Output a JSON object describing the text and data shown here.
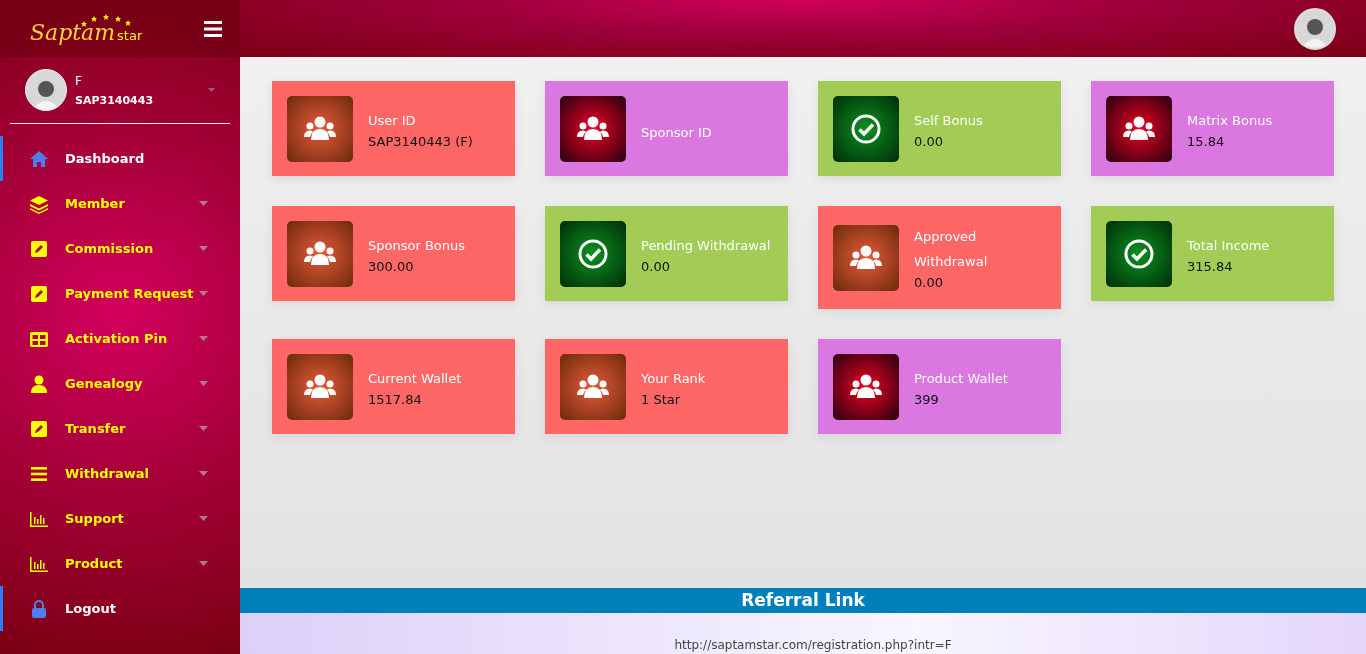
{
  "brand": {
    "logo_main": "Saptam",
    "logo_sub": "star"
  },
  "user": {
    "name": "F",
    "id": "SAP3140443"
  },
  "sidebar": {
    "items": [
      {
        "label": "Dashboard",
        "kind": "link"
      },
      {
        "label": "Member",
        "kind": "dropdown"
      },
      {
        "label": "Commission",
        "kind": "dropdown"
      },
      {
        "label": "Payment Request",
        "kind": "dropdown"
      },
      {
        "label": "Activation Pin",
        "kind": "dropdown"
      },
      {
        "label": "Genealogy",
        "kind": "dropdown"
      },
      {
        "label": "Transfer",
        "kind": "dropdown"
      },
      {
        "label": "Withdrawal",
        "kind": "dropdown"
      },
      {
        "label": "Support",
        "kind": "dropdown"
      },
      {
        "label": "Product",
        "kind": "dropdown"
      },
      {
        "label": "Logout",
        "kind": "link"
      }
    ]
  },
  "cards": [
    {
      "title": "User ID",
      "value": "SAP3140443 (F)",
      "color": "#ff6666",
      "kind": "users"
    },
    {
      "title": "Sponsor ID",
      "color": "#da77e0",
      "kind": "users"
    },
    {
      "title": "Self Bonus",
      "value": "0.00",
      "color": "#a2cc55",
      "kind": "check"
    },
    {
      "title": "Matrix Bonus",
      "value": "15.84",
      "color": "#da77e0",
      "kind": "users"
    },
    {
      "title": "Sponsor Bonus",
      "value": "300.00",
      "color": "#ff6666",
      "kind": "users"
    },
    {
      "title": "Pending Withdrawal",
      "value": "0.00",
      "color": "#a2cc55",
      "kind": "check"
    },
    {
      "title": "Approved Withdrawal",
      "value": "0.00",
      "color": "#ff6666",
      "kind": "users"
    },
    {
      "title": "Total Income",
      "value": "315.84",
      "color": "#a2cc55",
      "kind": "check"
    },
    {
      "title": "Current Wallet",
      "value": "1517.84",
      "color": "#ff6666",
      "kind": "users"
    },
    {
      "title": "Your Rank",
      "value": "1 Star",
      "color": "#ff6666",
      "kind": "users"
    },
    {
      "title": "Product Wallet",
      "value": "399",
      "color": "#da77e0",
      "kind": "users"
    }
  ],
  "referral": {
    "title": "Referral Link",
    "link": "http://saptamstar.com/registration.php?intr=F"
  }
}
